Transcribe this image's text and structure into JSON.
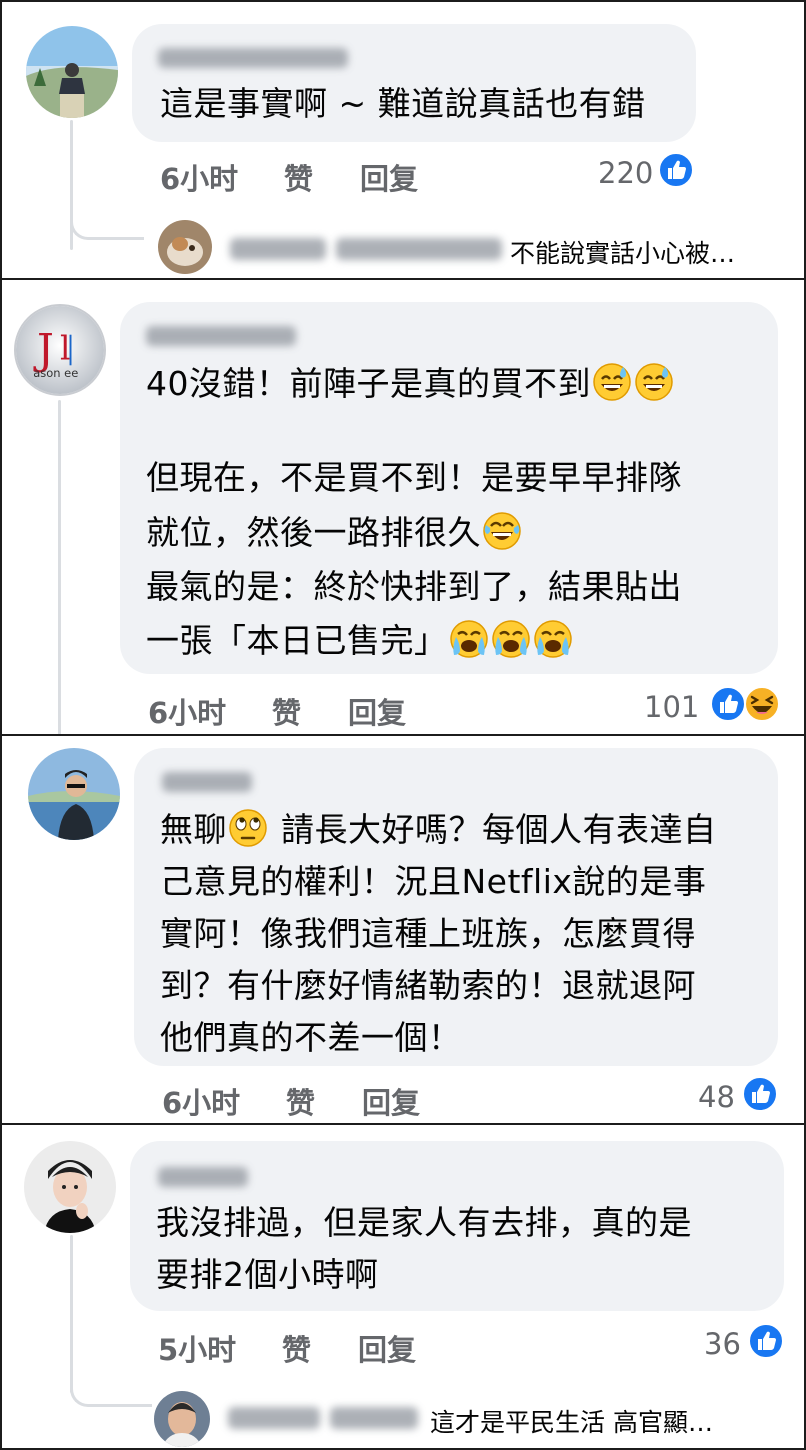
{
  "comments": [
    {
      "text_lines": [
        "這是事實啊 ~ 難道說真話也有錯"
      ],
      "time": "6小时",
      "like_label": "赞",
      "reply_label": "回复",
      "reaction_count": "220",
      "reply_preview": {
        "text": "不能說實話小心被…"
      }
    },
    {
      "text_lines": [
        "40沒錯！前陣子是真的買不到",
        "",
        "但現在，不是買不到！是要早早排隊",
        "就位，然後一路排很久",
        "最氣的是：終於快排到了，結果貼出",
        "一張「本日已售完」"
      ],
      "time": "6小时",
      "like_label": "赞",
      "reply_label": "回复",
      "reaction_count": "101",
      "avatar_text": "ason ee"
    },
    {
      "text_lines": [
        "無聊",
        "請長大好嗎？每個人有表達自",
        "己意見的權利！況且Netflix說的是事",
        "實阿！像我們這種上班族，怎麼買得",
        "到？有什麼好情緒勒索的！退就退阿",
        "他們真的不差一個！"
      ],
      "time": "6小时",
      "like_label": "赞",
      "reply_label": "回复",
      "reaction_count": "48"
    },
    {
      "text_lines": [
        "我沒排過，但是家人有去排，真的是",
        "要排2個小時啊"
      ],
      "time": "5小时",
      "like_label": "赞",
      "reply_label": "回复",
      "reaction_count": "36",
      "reply_preview": {
        "text": "這才是平民生活 高官顯…"
      }
    }
  ],
  "colors": {
    "bubble": "#f0f2f5",
    "meta_text": "#65676b",
    "like_blue": "#1877f2",
    "haha_yellow": "#f7b125",
    "thread_line": "#dadde1"
  },
  "icons": {
    "like": "like-reaction-icon",
    "haha": "haha-reaction-icon",
    "sweat_smile": "sweat-smile-emoji",
    "crying": "loudly-crying-emoji",
    "eye_roll": "eye-roll-emoji",
    "tears_of_joy": "tears-of-joy-emoji"
  }
}
